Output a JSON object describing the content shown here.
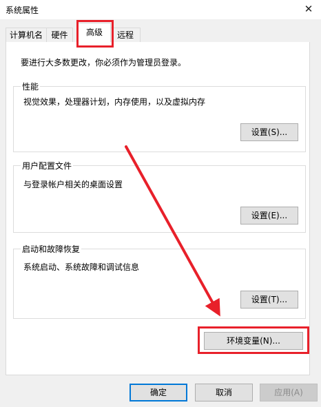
{
  "window": {
    "title": "系统属性",
    "close_glyph": "✕"
  },
  "tabs": [
    {
      "label": "计算机名"
    },
    {
      "label": "硬件"
    },
    {
      "label": "高级",
      "active": true
    },
    {
      "label": "远程"
    }
  ],
  "admin_notice": "要进行大多数更改，你必须作为管理员登录。",
  "groups": {
    "performance": {
      "title": "性能",
      "description": "视觉效果，处理器计划，内存使用，以及虚拟内存",
      "button": "设置(S)..."
    },
    "user_profiles": {
      "title": "用户配置文件",
      "description": "与登录帐户相关的桌面设置",
      "button": "设置(E)..."
    },
    "startup_recovery": {
      "title": "启动和故障恢复",
      "description": "系统启动、系统故障和调试信息",
      "button": "设置(T)..."
    }
  },
  "env_button": "环境变量(N)...",
  "footer": {
    "ok": "确定",
    "cancel": "取消",
    "apply": "应用(A)"
  },
  "annotation": {
    "color": "#e8202a"
  }
}
